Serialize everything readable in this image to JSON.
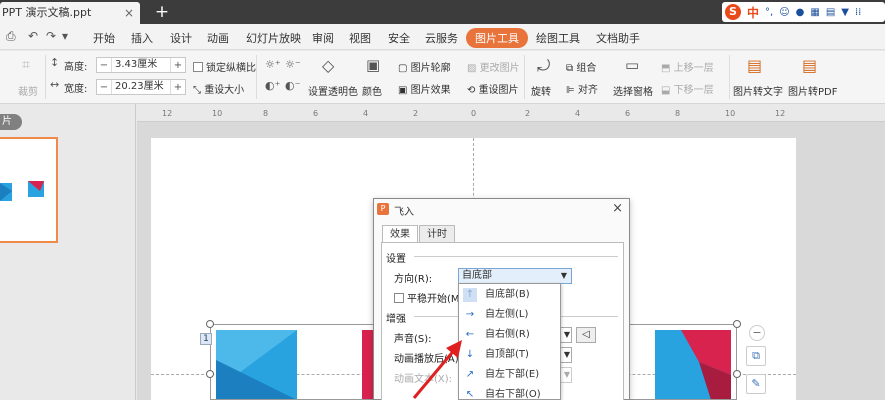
{
  "titlebar": {
    "doc_tab": "PPT 演示文稿.ppt",
    "close": "×",
    "new_tab": "+",
    "ime_zh": "中"
  },
  "menubar": {
    "items": [
      "开始",
      "插入",
      "设计",
      "动画",
      "幻灯片放映",
      "审阅",
      "视图",
      "安全",
      "云服务",
      "图片工具",
      "绘图工具",
      "文档助手"
    ],
    "active": "图片工具"
  },
  "ribbon": {
    "crop": "裁剪",
    "height_label": "高度:",
    "height_value": "3.43厘米",
    "width_label": "宽度:",
    "width_value": "20.23厘米",
    "lock_ratio": "锁定纵横比",
    "reset_size": "重设大小",
    "set_transparent": "设置透明色",
    "color": "颜色",
    "picture_outline": "图片轮廓",
    "picture_effect": "图片效果",
    "change_picture": "更改图片",
    "reset_picture": "重设图片",
    "rotate": "旋转",
    "group": "组合",
    "align": "对齐",
    "selection_pane": "选择窗格",
    "bring_forward": "上移一层",
    "send_backward": "下移一层",
    "pic_to_text": "图片转文字",
    "pic_to_pdf": "图片转PDF"
  },
  "leftpanel": {
    "tab": "片"
  },
  "ruler": {
    "ticks": [
      "12",
      "10",
      "8",
      "6",
      "4",
      "2",
      "0",
      "2",
      "4",
      "6",
      "8",
      "10",
      "12"
    ]
  },
  "slide": {
    "badge": "1"
  },
  "dialog": {
    "title": "飞入",
    "close": "×",
    "tabs": [
      "效果",
      "计时"
    ],
    "settings_group": "设置",
    "direction_label": "方向(R):",
    "direction_value": "自底部",
    "smooth_start": "平稳开始(M)",
    "enhance_group": "增强",
    "sound_label": "声音(S):",
    "after_anim_label": "动画播放后(A):",
    "anim_text_label": "动画文本(X):"
  },
  "dropdown": {
    "items": [
      {
        "icon": "↑",
        "label": "自底部(B)"
      },
      {
        "icon": "→",
        "label": "自左侧(L)"
      },
      {
        "icon": "←",
        "label": "自右侧(R)"
      },
      {
        "icon": "↓",
        "label": "自顶部(T)"
      },
      {
        "icon": "↗",
        "label": "自左下部(E)"
      },
      {
        "icon": "↖",
        "label": "自右下部(O)"
      }
    ]
  },
  "colors": {
    "accent": "#e8743b",
    "titlebar": "#3c3c3c",
    "slide_blue": "#29a3df",
    "slide_red": "#d8234f"
  }
}
